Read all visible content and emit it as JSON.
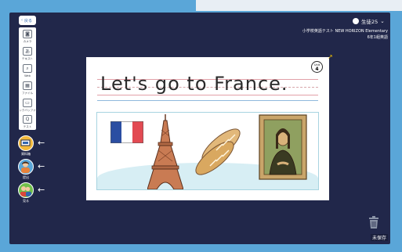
{
  "nav": {
    "back_label": "戻る"
  },
  "tools": [
    {
      "name": "camera",
      "label": "カメラ",
      "glyph": "◙"
    },
    {
      "name": "text",
      "label": "テキスト",
      "glyph": "あ"
    },
    {
      "name": "web",
      "label": "Web",
      "glyph": "⌕"
    },
    {
      "name": "file",
      "label": "ファイル",
      "glyph": "▦"
    },
    {
      "name": "link",
      "label": "リンクバッファー",
      "glyph": "▭"
    },
    {
      "name": "test",
      "label": "テスト",
      "glyph": "Q"
    }
  ],
  "side_buttons": [
    {
      "label": "資料箱"
    },
    {
      "label": "提出"
    },
    {
      "label": "見る"
    }
  ],
  "header": {
    "user_name": "生徒25",
    "course_line1": "小学校英語テスト NEW HORIZON Elementary",
    "course_line2": "6年1組英語"
  },
  "slide": {
    "title": "Let's go to France.",
    "unit_label": "Unit",
    "unit_number": "4"
  },
  "footer": {
    "unsaved_label": "未保存"
  },
  "colors": {
    "frame": "#5aa6d8",
    "screen": "#21274a",
    "accent": "#f2c200"
  }
}
